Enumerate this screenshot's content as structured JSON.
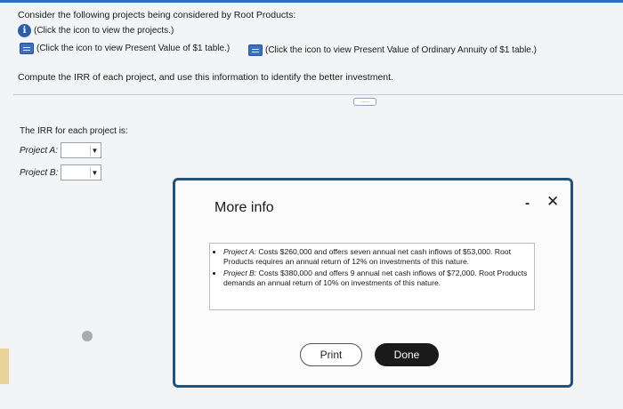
{
  "question": {
    "title": "Consider the following projects being considered by Root Products:",
    "link_view_projects": "(Click the icon to view the projects.)",
    "link_pv_table": "(Click the icon to view Present Value of $1 table.)",
    "link_pv_annuity_table": "(Click the icon to view Present Value of Ordinary Annuity of $1 table.)",
    "instruction": "Compute the IRR of each project, and use this information to identify the better investment.",
    "icons": {
      "info": "info-icon",
      "table": "table-icon"
    }
  },
  "toggle": {
    "label": "....."
  },
  "answer": {
    "label": "The IRR for each project is:",
    "projects": [
      {
        "label": "Project A:",
        "value": ""
      },
      {
        "label": "Project B:",
        "value": ""
      }
    ],
    "dropdown_arrow": "▼"
  },
  "modal": {
    "title": "More info",
    "minimize": "-",
    "close": "✕",
    "items": [
      {
        "name": "Project A:",
        "text": "Costs $260,000 and offers seven annual net cash inflows of $53,000. Root Products requires an annual return of 12% on investments of this nature."
      },
      {
        "name": "Project B:",
        "text": "Costs $380,000 and offers 9 annual net cash inflows of $72,000. Root Products demands an annual return of 10% on investments of this nature."
      }
    ],
    "print_label": "Print",
    "done_label": "Done"
  },
  "colors": {
    "modal_border": "#24527f",
    "link_icon": "#2a5fa8",
    "done_button": "#1a1a1a",
    "top_bar": "#2f6fb7"
  }
}
